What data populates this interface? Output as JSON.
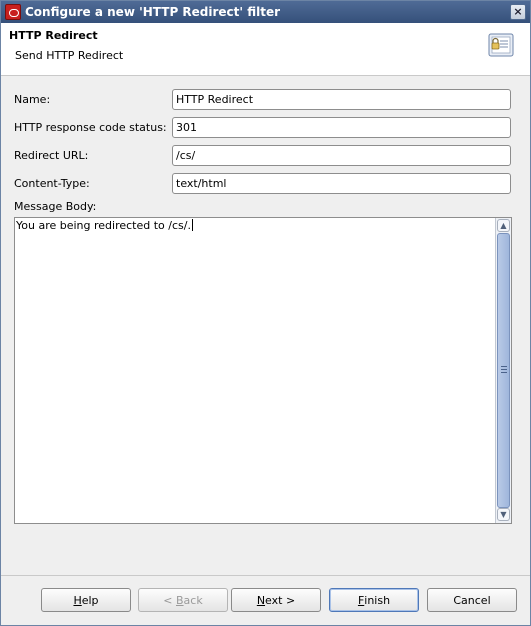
{
  "window": {
    "title": "Configure a new 'HTTP Redirect' filter",
    "close_glyph": "×"
  },
  "header": {
    "title": "HTTP Redirect",
    "subtitle": "Send HTTP Redirect",
    "icon": "clipboard-lock-icon"
  },
  "form": {
    "name_label": "Name:",
    "name_value": "HTTP Redirect",
    "status_label": "HTTP response code status:",
    "status_value": "301",
    "url_label": "Redirect URL:",
    "url_value": "/cs/",
    "content_type_label": "Content-Type:",
    "content_type_value": "text/html",
    "body_label": "Message Body:",
    "body_value": "You are being redirected to /cs/."
  },
  "buttons": {
    "help": {
      "mnemonic": "H",
      "rest": "elp"
    },
    "back": {
      "pre": "< ",
      "mnemonic": "B",
      "rest": "ack"
    },
    "next": {
      "mnemonic": "N",
      "rest": "ext >"
    },
    "finish": {
      "mnemonic": "F",
      "rest": "inish"
    },
    "cancel": "Cancel"
  },
  "colors": {
    "titlebar": "#35507a",
    "default_button_border": "#4f78b8"
  }
}
